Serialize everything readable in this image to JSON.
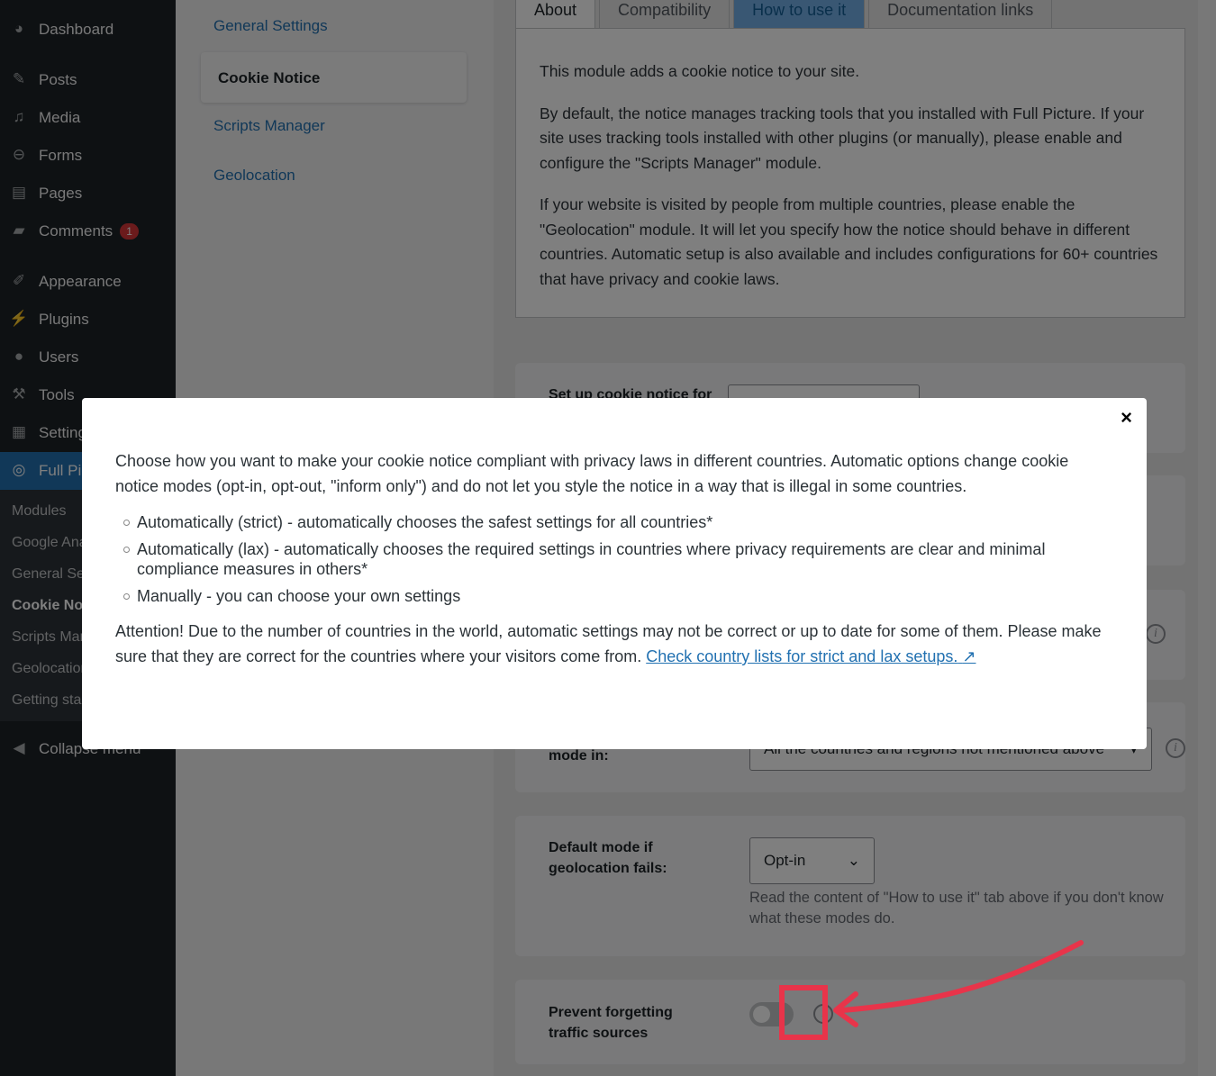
{
  "sidebar": {
    "items": [
      {
        "label": "Dashboard",
        "icon": "dashboard-icon"
      },
      {
        "label": "Posts",
        "icon": "pin-icon"
      },
      {
        "label": "Media",
        "icon": "media-icon"
      },
      {
        "label": "Forms",
        "icon": "forms-icon"
      },
      {
        "label": "Pages",
        "icon": "pages-icon"
      },
      {
        "label": "Comments",
        "icon": "comment-icon",
        "badge": "1"
      },
      {
        "label": "Appearance",
        "icon": "paintbrush-icon"
      },
      {
        "label": "Plugins",
        "icon": "plugin-icon"
      },
      {
        "label": "Users",
        "icon": "user-icon"
      },
      {
        "label": "Tools",
        "icon": "wrench-icon"
      },
      {
        "label": "Settings",
        "icon": "settings-icon"
      },
      {
        "label": "Full Picture",
        "icon": "chart-icon"
      }
    ],
    "submenu": [
      "Modules",
      "Google Analytics",
      "General Settings",
      "Cookie Notice",
      "Scripts Manager",
      "Geolocation",
      "Getting started"
    ],
    "collapse": "Collapse menu"
  },
  "subnav": [
    "General Settings",
    "Cookie Notice",
    "Scripts Manager",
    "Geolocation"
  ],
  "tabs": [
    "About",
    "Compatibility",
    "How to use it",
    "Documentation links"
  ],
  "about": [
    "This module adds a cookie notice to your site.",
    "By default, the notice manages tracking tools that you installed with Full Picture. If your site uses tracking tools installed with other plugins (or manually), please enable and configure the \"Scripts Manager\" module.",
    "If your website is visited by people from multiple countries, please enable the \"Geolocation\" module. It will let you specify how the notice should behave in different countries. Automatic setup is also available and includes configurations for 60+ countries that have privacy and cookie laws."
  ],
  "settings": {
    "setup_label": "Set up cookie notice for",
    "mode_label": "mode in:",
    "mode_value": "All the countries and regions not mentioned above",
    "default_label": "Default mode if geolocation fails:",
    "default_value": "Opt-in",
    "default_help": "Read the content of \"How to use it\" tab above if you don't know what these modes do.",
    "prevent_label": "Prevent forgetting traffic sources",
    "prevent_enabled": false
  },
  "modal": {
    "close": "×",
    "intro": "Choose how you want to make your cookie notice compliant with privacy laws in different countries. Automatic options change cookie notice modes (opt-in, opt-out, \"inform only\") and do not let you style the notice in a way that is illegal in some countries.",
    "options": [
      "Automatically (strict) - automatically chooses the safest settings for all countries*",
      "Automatically (lax) - automatically chooses the required settings in countries where privacy requirements are clear and minimal compliance measures in others*",
      "Manually - you can choose your own settings"
    ],
    "attention": "Attention! Due to the number of countries in the world, automatic settings may not be correct or up to date for some of them. Please make sure that they are correct for the countries where your visitors come from. ",
    "link": "Check country lists for strict and lax setups."
  },
  "annotation_color": "#e8344a"
}
